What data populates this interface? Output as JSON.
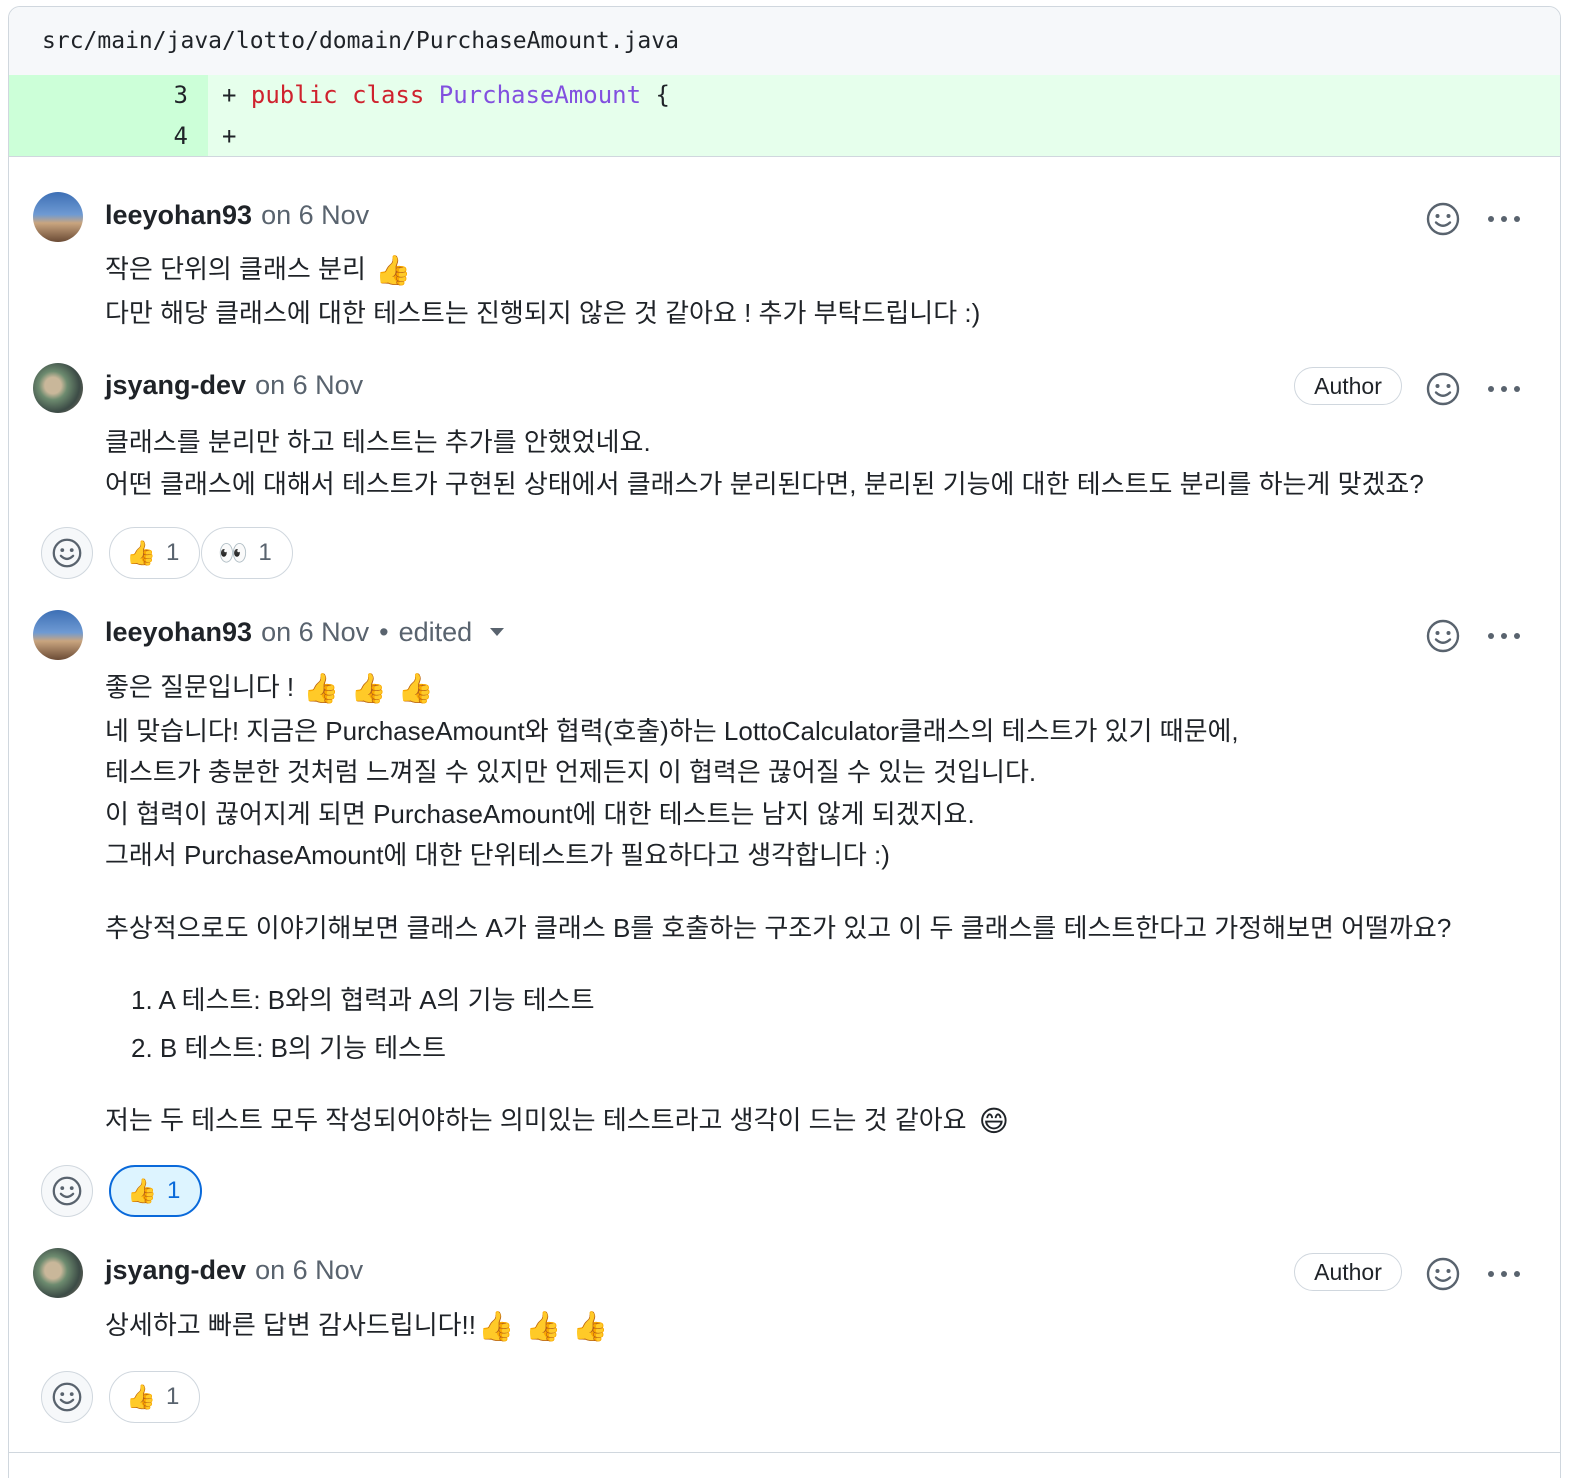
{
  "file": {
    "path": "src/main/java/lotto/domain/PurchaseAmount.java",
    "lines": [
      {
        "num": "3",
        "plus": "+ ",
        "kw1": "public",
        "kw2": "class",
        "cls": "PurchaseAmount",
        "rest": " {"
      },
      {
        "num": "4",
        "plus": "+"
      }
    ]
  },
  "comments": [
    {
      "author": "leeyohan93",
      "date": "on 6 Nov",
      "lines": [
        "작은 단위의 클래스 분리",
        "다만 해당 클래스에 대한 테스트는 진행되지 않은 것 같아요 ! 추가 부탁드립니다 :)"
      ],
      "emoji": "👍"
    },
    {
      "author": "jsyang-dev",
      "date": "on 6 Nov",
      "badge": "Author",
      "lines": [
        "클래스를 분리만 하고 테스트는 추가를 안했었네요.",
        "어떤 클래스에 대해서 테스트가 구현된 상태에서 클래스가 분리된다면, 분리된 기능에 대한 테스트도 분리를 하는게 맞겠죠?"
      ],
      "reactions": [
        {
          "emoji": "👍",
          "count": "1"
        },
        {
          "emoji": "👀",
          "count": "1"
        }
      ]
    },
    {
      "author": "leeyohan93",
      "date": "on 6 Nov",
      "edited": "edited",
      "lines": [
        "좋은 질문입니다 !",
        "네 맞습니다! 지금은 PurchaseAmount와 협력(호출)하는 LottoCalculator클래스의 테스트가 있기 때문에,",
        "테스트가 충분한 것처럼 느껴질 수 있지만 언제든지 이 협력은 끊어질 수 있는 것입니다.",
        "이 협력이 끊어지게 되면 PurchaseAmount에 대한 테스트는 남지 않게 되겠지요.",
        "그래서 PurchaseAmount에 대한 단위테스트가 필요하다고 생각합니다 :)"
      ],
      "paragraph2": "추상적으로도 이야기해보면 클래스 A가 클래스 B를 호출하는 구조가 있고 이 두 클래스를 테스트한다고 가정해보면 어떨까요?",
      "list": [
        "1. A 테스트: B와의 협력과 A의 기능 테스트",
        "2. B 테스트: B의 기능 테스트"
      ],
      "closing": "저는 두 테스트 모두 작성되어야하는 의미있는 테스트라고 생각이 드는 것 같아요",
      "thumbs": "👍",
      "grin": "😄",
      "reactions": [
        {
          "emoji": "👍",
          "count": "1"
        }
      ]
    },
    {
      "author": "jsyang-dev",
      "date": "on 6 Nov",
      "badge": "Author",
      "lines": [
        "상세하고 빠른 답변 감사드립니다!!"
      ],
      "emoji": "👍",
      "reactions": [
        {
          "emoji": "👍",
          "count": "1"
        }
      ]
    }
  ]
}
